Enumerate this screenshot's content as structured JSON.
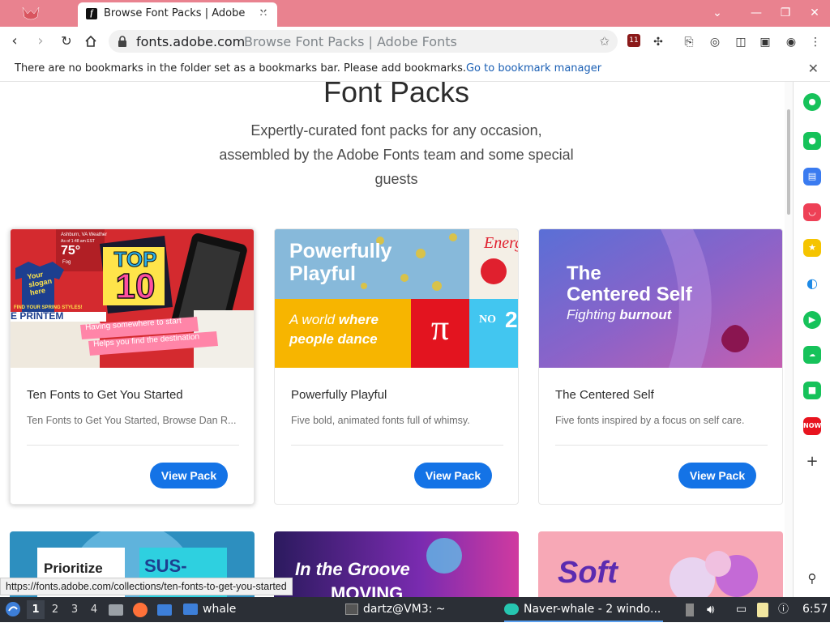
{
  "browser": {
    "tab": {
      "title": "Browse Font Packs | Adobe Fonts"
    },
    "url": {
      "domain": "fonts.adobe.com",
      "page_title": "Browse Font Packs | Adobe Fonts"
    },
    "bookmarks_bar": {
      "message": "There are no bookmarks in the folder set as a bookmarks bar. Please add bookmarks.",
      "link": "Go to bookmark manager"
    },
    "extension_badge": "11",
    "status_url": "https://fonts.adobe.com/collections/ten-fonts-to-get-you-started",
    "accent": "#e9828f"
  },
  "page": {
    "heading": "Font Packs",
    "subtitle": "Expertly-curated font packs for any occasion, assembled by the Adobe Fonts team and some special guests",
    "cards": [
      {
        "title": "Ten Fonts to Get You Started",
        "description": "Ten Fonts to Get You Started, Browse Dan R...",
        "button": "View Pack",
        "image": {
          "weather_city": "Ashburn, VA Weather",
          "weather_time": "As of 1:48 am EST",
          "temp": "75°",
          "condition": "Fog",
          "shirt_text": "Your slogan here",
          "top": "TOP",
          "ten": "10",
          "spring": "FIND YOUR SPRING STYLES!",
          "ticker": "E PRINTEM",
          "tag1": "Having somewhere to start",
          "tag2": "Helps you find the destination"
        }
      },
      {
        "title": "Powerfully Playful",
        "description": "Five bold, animated fonts full of whimsy.",
        "button": "View Pack",
        "image": {
          "headline1": "Powerfully",
          "headline2": "Playful",
          "energy": "Energ",
          "line1a": "A world ",
          "line1b": "where",
          "line2": "people dance",
          "pi": "π",
          "no": "NO",
          "num": "2"
        }
      },
      {
        "title": "The Centered Self",
        "description": "Five fonts inspired by a focus on self care.",
        "button": "View Pack",
        "image": {
          "line1": "The",
          "line2": "Centered Self",
          "line3a": "Fighting ",
          "line3b": "burnout"
        }
      }
    ],
    "next_row": [
      {
        "text1": "Prioritize",
        "text2": "SUS-"
      },
      {
        "text1": "In the Groove",
        "text2": "MOVING"
      },
      {
        "text1": "Soft"
      }
    ]
  },
  "sidebar": {
    "icons": [
      "spotify-like-icon",
      "notification-icon",
      "wallet-icon",
      "pocket-icon",
      "star-icon",
      "edge-icon",
      "player-icon",
      "weather-icon",
      "line-icon",
      "now-icon",
      "add-icon",
      "pin-icon"
    ],
    "now_label": "NOW."
  },
  "taskbar": {
    "workspaces": [
      "1",
      "2",
      "3",
      "4"
    ],
    "folder_label": "whale",
    "terminal_label": "dartz@VM3: ~",
    "browser_label": "Naver-whale - 2 windo...",
    "clock": "6:57"
  }
}
